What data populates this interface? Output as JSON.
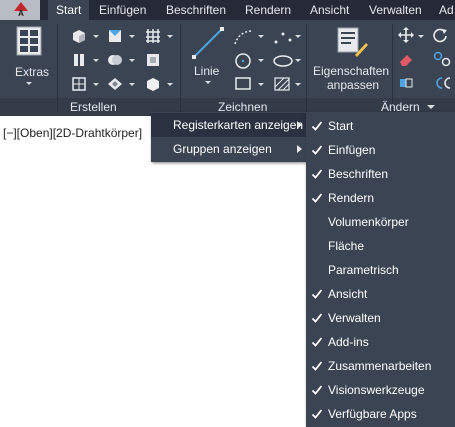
{
  "tabs": [
    "Start",
    "Einfügen",
    "Beschriften",
    "Rendern",
    "Ansicht",
    "Verwalten",
    "Ad"
  ],
  "app_button": {
    "letter": "A"
  },
  "ribbon": {
    "extras_label": "Extras",
    "erstellen_title": "Erstellen",
    "linie_label": "Linie",
    "zeichnen_title": "Zeichnen",
    "eigenschaften_label_1": "Eigenschaften",
    "eigenschaften_label_2": "anpassen",
    "aendern_title": "Ändern"
  },
  "viewport_label": "[−][Oben][2D-Drahtkörper]",
  "menu": {
    "items": [
      {
        "label": "Registerkarten anzeigen"
      },
      {
        "label": "Gruppen anzeigen"
      }
    ]
  },
  "submenu": {
    "items": [
      {
        "label": "Start",
        "checked": true
      },
      {
        "label": "Einfügen",
        "checked": true
      },
      {
        "label": "Beschriften",
        "checked": true
      },
      {
        "label": "Rendern",
        "checked": true
      },
      {
        "label": "Volumenkörper",
        "checked": false
      },
      {
        "label": "Fläche",
        "checked": false
      },
      {
        "label": "Parametrisch",
        "checked": false
      },
      {
        "label": "Ansicht",
        "checked": true
      },
      {
        "label": "Verwalten",
        "checked": true
      },
      {
        "label": "Add-ins",
        "checked": true
      },
      {
        "label": "Zusammenarbeiten",
        "checked": true
      },
      {
        "label": "Visionswerkzeuge",
        "checked": true
      },
      {
        "label": "Verfügbare Apps",
        "checked": true
      }
    ]
  },
  "colors": {
    "tab_bar": "#252a36",
    "ribbon": "#3b4453",
    "menu": "#3b4453",
    "menu_hover": "#2b3140",
    "text": "#ffffff"
  }
}
